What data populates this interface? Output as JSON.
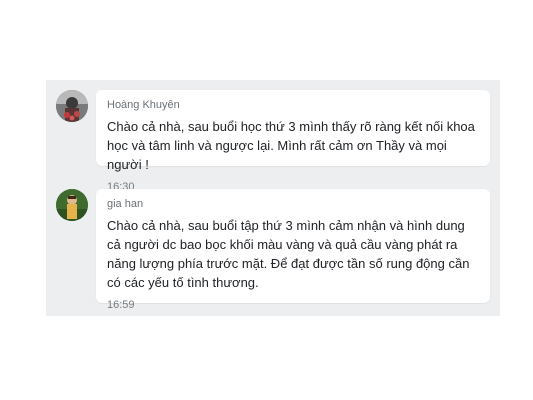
{
  "messages": [
    {
      "author": "Hoàng Khuyên",
      "text": "Chào cả nhà, sau buổi học thứ 3 mình thấy rõ ràng kết nối khoa học và tâm linh và ngược lại. Mình rất cảm ơn Thầy và mọi người !",
      "time": "16:30",
      "avatar_icon": "user-avatar-photo"
    },
    {
      "author": "gia han",
      "text": "Chào cả nhà, sau buổi tập thứ 3 mình cảm nhận và hình dung cả người dc bao bọc khối màu vàng và quả cầu vàng phát ra năng lượng phía trước mặt. Để đạt được tần số rung động cần có các yếu tố tình thương.",
      "time": "16:59",
      "avatar_icon": "user-avatar-photo"
    }
  ]
}
